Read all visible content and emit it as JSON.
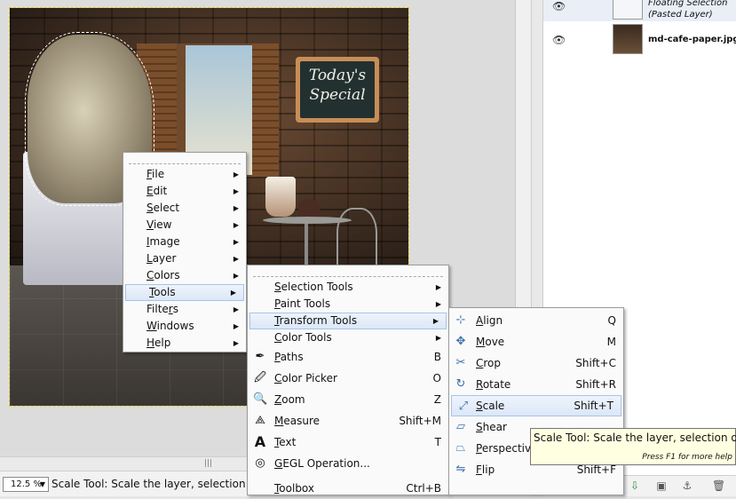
{
  "canvas": {
    "chalkboard_text_line1": "Today's",
    "chalkboard_text_line2": "Special"
  },
  "status_bar": {
    "zoom_value": "12.5 %",
    "message": "Scale Tool: Scale the layer, selection or pat"
  },
  "layers": [
    {
      "name": "Floating Selection",
      "sub": "(Pasted Layer)"
    },
    {
      "name": "md-cafe-paper.jpg",
      "sub": ""
    }
  ],
  "main_menu": {
    "items": [
      {
        "label": "File",
        "key": "F"
      },
      {
        "label": "Edit",
        "key": "E"
      },
      {
        "label": "Select",
        "key": "S"
      },
      {
        "label": "View",
        "key": "V"
      },
      {
        "label": "Image",
        "key": "I"
      },
      {
        "label": "Layer",
        "key": "L"
      },
      {
        "label": "Colors",
        "key": "C"
      },
      {
        "label": "Tools",
        "key": "T"
      },
      {
        "label": "Filters",
        "key": "r"
      },
      {
        "label": "Windows",
        "key": "W"
      },
      {
        "label": "Help",
        "key": "H"
      }
    ],
    "highlighted": "Tools"
  },
  "tools_menu": {
    "items": [
      {
        "label": "Selection Tools",
        "shortcut": "",
        "icon": "",
        "submenu": true
      },
      {
        "label": "Paint Tools",
        "shortcut": "",
        "icon": "",
        "submenu": true
      },
      {
        "label": "Transform Tools",
        "shortcut": "",
        "icon": "",
        "submenu": true
      },
      {
        "label": "Color Tools",
        "shortcut": "",
        "icon": "",
        "submenu": true
      },
      {
        "label": "Paths",
        "shortcut": "B",
        "icon": "paths-icon",
        "submenu": false
      },
      {
        "label": "Color Picker",
        "shortcut": "O",
        "icon": "color-picker-icon",
        "submenu": false
      },
      {
        "label": "Zoom",
        "shortcut": "Z",
        "icon": "zoom-icon",
        "submenu": false
      },
      {
        "label": "Measure",
        "shortcut": "Shift+M",
        "icon": "measure-icon",
        "submenu": false
      },
      {
        "label": "Text",
        "shortcut": "T",
        "icon": "text-icon",
        "submenu": false
      },
      {
        "label": "GEGL Operation...",
        "shortcut": "",
        "icon": "gegl-icon",
        "submenu": false
      },
      {
        "label": "Toolbox",
        "shortcut": "Ctrl+B",
        "icon": "",
        "submenu": false
      }
    ],
    "highlighted": "Transform Tools"
  },
  "transform_menu": {
    "items": [
      {
        "label": "Align",
        "shortcut": "Q",
        "icon": "align-icon"
      },
      {
        "label": "Move",
        "shortcut": "M",
        "icon": "move-icon"
      },
      {
        "label": "Crop",
        "shortcut": "Shift+C",
        "icon": "crop-icon"
      },
      {
        "label": "Rotate",
        "shortcut": "Shift+R",
        "icon": "rotate-icon"
      },
      {
        "label": "Scale",
        "shortcut": "Shift+T",
        "icon": "scale-icon"
      },
      {
        "label": "Shear",
        "shortcut": "",
        "icon": "shear-icon"
      },
      {
        "label": "Perspective",
        "shortcut": "",
        "icon": "perspective-icon"
      },
      {
        "label": "Flip",
        "shortcut": "Shift+F",
        "icon": "flip-icon"
      }
    ],
    "highlighted": "Scale"
  },
  "tooltip": {
    "text": "Scale Tool: Scale the layer, selection or path",
    "hint": "Press F1 for more help"
  }
}
